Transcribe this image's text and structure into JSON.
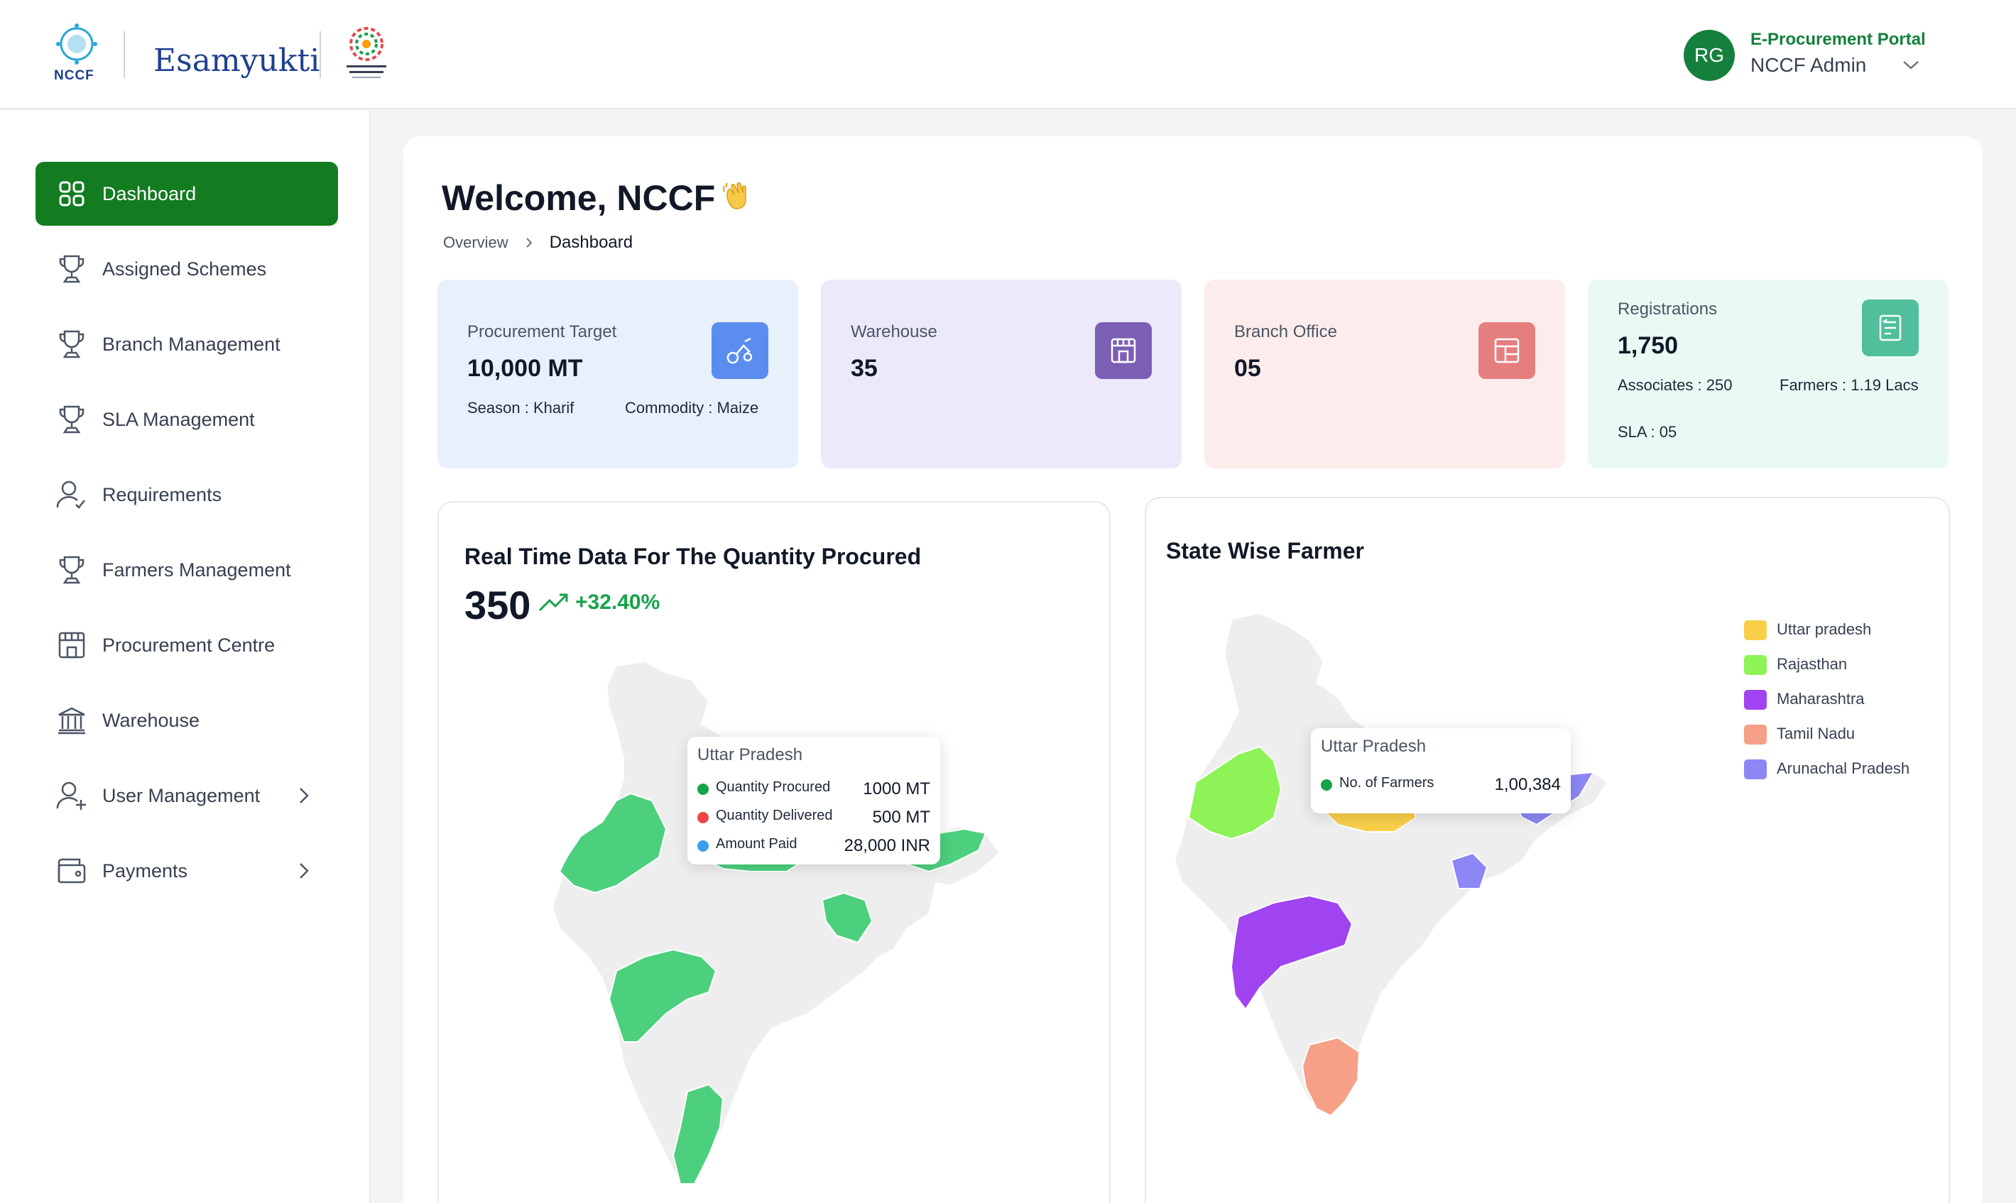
{
  "header": {
    "logo_nccf_text": "NCCF",
    "logo_esamyukti_text": "Esamyukti",
    "portal_label": "E-Procurement Portal",
    "user_name": "NCCF Admin",
    "avatar_initials": "RG"
  },
  "sidebar": {
    "items": [
      {
        "label": "Dashboard",
        "icon": "grid-icon",
        "active": true
      },
      {
        "label": "Assigned Schemes",
        "icon": "trophy-icon"
      },
      {
        "label": "Branch Management",
        "icon": "trophy-icon"
      },
      {
        "label": "SLA Management",
        "icon": "trophy-icon"
      },
      {
        "label": "Requirements",
        "icon": "user-check-icon"
      },
      {
        "label": "Farmers Management",
        "icon": "trophy-icon"
      },
      {
        "label": "Procurement Centre",
        "icon": "store-icon"
      },
      {
        "label": "Warehouse",
        "icon": "bank-icon"
      },
      {
        "label": "User Management",
        "icon": "user-plus-icon",
        "has_submenu": true
      },
      {
        "label": "Payments",
        "icon": "wallet-icon",
        "has_submenu": true
      }
    ]
  },
  "main": {
    "welcome": "Welcome,  NCCF",
    "breadcrumb": {
      "parent": "Overview",
      "current": "Dashboard"
    },
    "stats": {
      "procurement": {
        "label": "Procurement Target",
        "value": "10,000 MT",
        "season": "Season : Kharif",
        "commodity": "Commodity : Maize",
        "color": "#5b8def"
      },
      "warehouse": {
        "label": "Warehouse",
        "value": "35",
        "color": "#7c5fb5"
      },
      "branch": {
        "label": "Branch Office",
        "value": "05",
        "color": "#e57f7f"
      },
      "registrations": {
        "label": "Registrations",
        "value": "1,750",
        "associates": "Associates : 250",
        "farmers": "Farmers : 1.19 Lacs",
        "sla": "SLA : 05",
        "color": "#4fbf9c"
      }
    },
    "quantity_panel": {
      "title": "Real Time Data For The Quantity Procured",
      "value": "350",
      "trend": "+32.40%",
      "tooltip": {
        "state": "Uttar Pradesh",
        "rows": [
          {
            "label": "Quantity Procured",
            "value": "1000 MT",
            "color": "#16a34a"
          },
          {
            "label": "Quantity Delivered",
            "value": "500 MT",
            "color": "#ef4444"
          },
          {
            "label": "Amount Paid",
            "value": "28,000 INR",
            "color": "#3b9eea"
          }
        ]
      }
    },
    "farmer_panel": {
      "title": "State Wise Farmer",
      "tooltip": {
        "state": "Uttar Pradesh",
        "label": "No. of Farmers",
        "value": "1,00,384",
        "color": "#16a34a"
      },
      "legend": [
        {
          "label": "Uttar pradesh",
          "color": "#f9cf4a"
        },
        {
          "label": "Rajasthan",
          "color": "#8ef357"
        },
        {
          "label": "Maharashtra",
          "color": "#a043f0"
        },
        {
          "label": "Tamil Nadu",
          "color": "#f7a088"
        },
        {
          "label": "Arunachal Pradesh",
          "color": "#8d86f5"
        }
      ]
    }
  }
}
